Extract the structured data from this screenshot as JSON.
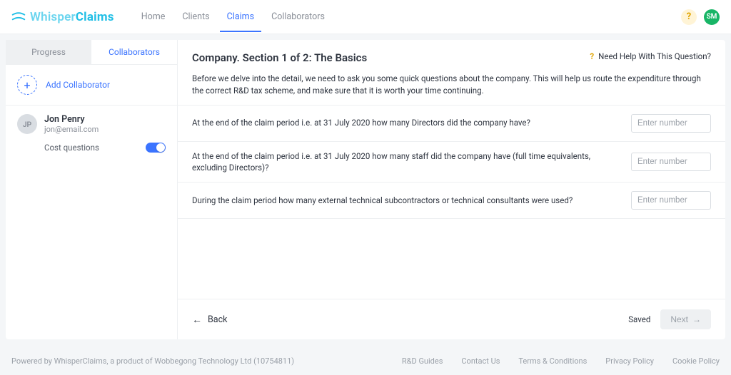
{
  "brand": {
    "name": "WhisperClaims"
  },
  "nav": {
    "items": [
      {
        "label": "Home",
        "active": false
      },
      {
        "label": "Clients",
        "active": false
      },
      {
        "label": "Claims",
        "active": true
      },
      {
        "label": "Collaborators",
        "active": false
      }
    ],
    "avatar_initials": "SM"
  },
  "sidebar": {
    "tabs": {
      "progress": "Progress",
      "collaborators": "Collaborators"
    },
    "add_label": "Add Collaborator",
    "collaborator": {
      "initials": "JP",
      "name": "Jon Penry",
      "email": "jon@email.com",
      "toggle_label": "Cost questions",
      "toggle_on": true
    }
  },
  "main": {
    "title": "Company. Section 1 of 2: The Basics",
    "help_label": "Need Help With This Question?",
    "intro": "Before we delve into the detail, we need to ask you some quick questions about the company. This will help us route the expenditure through the correct R&D tax scheme, and make sure that it is worth your time continuing.",
    "questions": [
      {
        "text": "At the end of the claim period i.e. at 31 July 2020 how many Directors did the company have?",
        "placeholder": "Enter number"
      },
      {
        "text": "At the end of the claim period i.e. at 31 July 2020 how many staff did the company have (full time equivalents, excluding Directors)?",
        "placeholder": "Enter number"
      },
      {
        "text": "During the claim period how many external technical subcontractors or technical consultants were used?",
        "placeholder": "Enter number"
      }
    ],
    "back_label": "Back",
    "saved_label": "Saved",
    "next_label": "Next"
  },
  "footer": {
    "powered": "Powered by WhisperClaims, a product of Wobbegong Technology Ltd (10754811)",
    "links": [
      "R&D Guides",
      "Contact Us",
      "Terms & Conditions",
      "Privacy Policy",
      "Cookie Policy"
    ]
  }
}
